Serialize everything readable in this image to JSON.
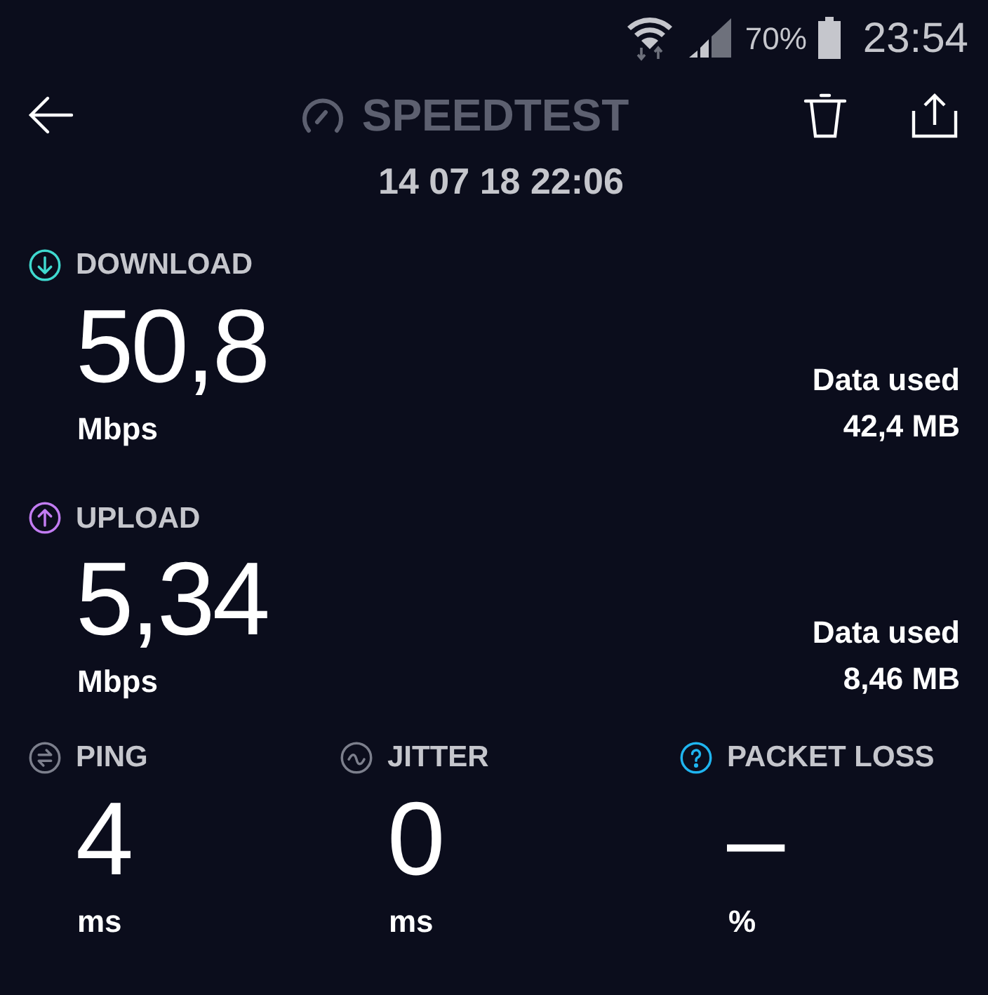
{
  "status_bar": {
    "battery": "70%",
    "time": "23:54"
  },
  "header": {
    "title": "SPEEDTEST",
    "date": "14 07 18 22:06"
  },
  "results": [
    {
      "kind": "download",
      "label": "DOWNLOAD",
      "color": "#3fd9cf",
      "value": "50,8",
      "unit": "Mbps",
      "data_label": "Data used",
      "data_value": "42,4 MB"
    },
    {
      "kind": "upload",
      "label": "UPLOAD",
      "color": "#c27cf2",
      "value": "5,34",
      "unit": "Mbps",
      "data_label": "Data used",
      "data_value": "8,46 MB"
    }
  ],
  "metrics": [
    {
      "kind": "ping",
      "label": "PING",
      "color": "#7c7f8c",
      "value": "4",
      "unit": "ms"
    },
    {
      "kind": "jitter",
      "label": "JITTER",
      "color": "#7c7f8c",
      "value": "0",
      "unit": "ms"
    },
    {
      "kind": "packet_loss",
      "label": "PACKET LOSS",
      "color": "#1fb5f0",
      "value": "–",
      "unit": "%"
    }
  ]
}
